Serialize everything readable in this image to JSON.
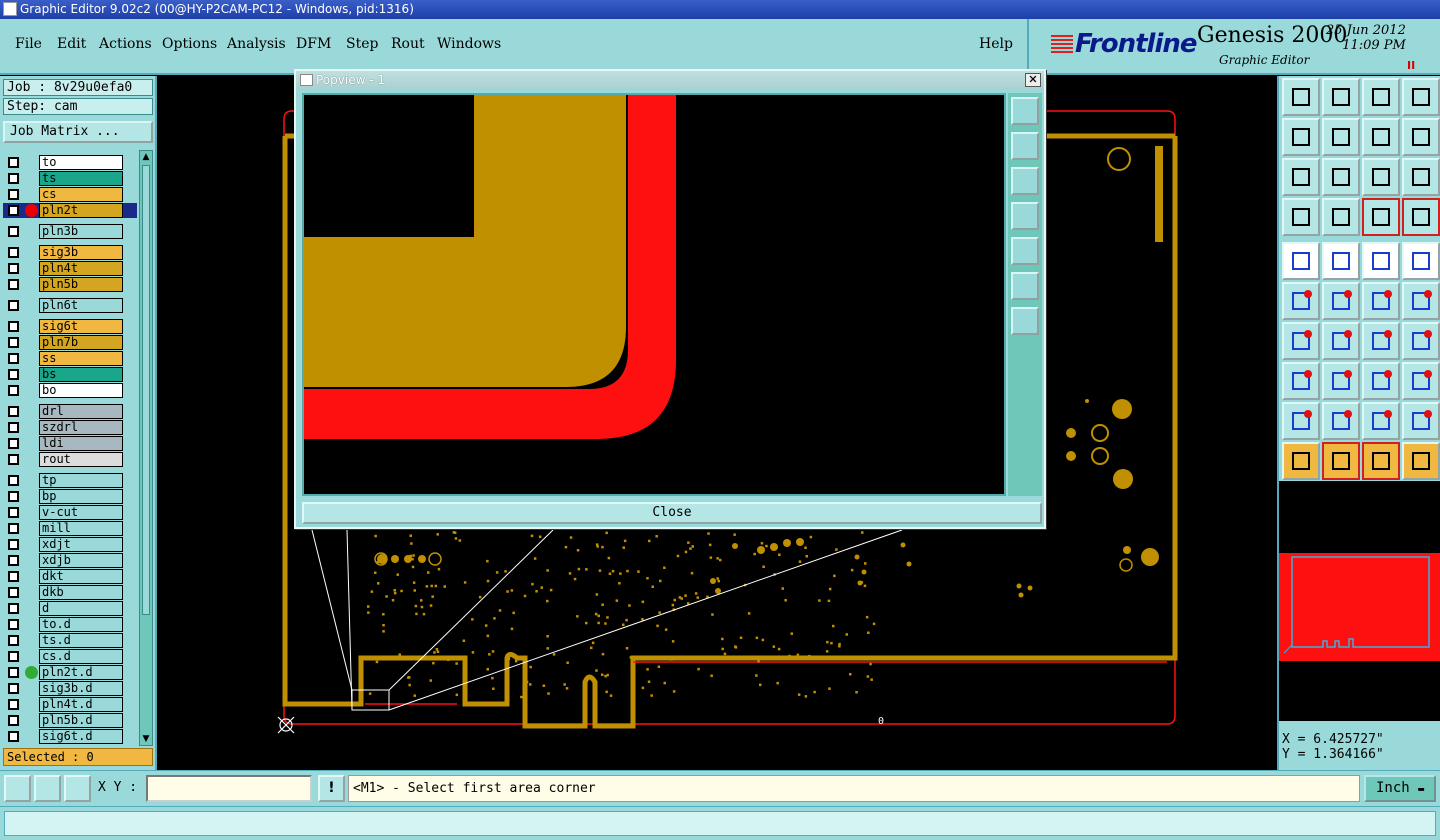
{
  "window": {
    "title": "Graphic Editor 9.02c2 (00@HY-P2CAM-PC12 - Windows, pid:1316)"
  },
  "menu": {
    "items": [
      "File",
      "Edit",
      "Actions",
      "Options",
      "Analysis",
      "DFM",
      "Step",
      "Rout",
      "Windows"
    ],
    "help": "Help"
  },
  "brand": {
    "logo": "Frontline",
    "product": "Genesis 2000",
    "subtitle": "Graphic Editor",
    "date": "25 Jun 2012",
    "time": "11:09 PM",
    "pause_glyph": "II"
  },
  "job": {
    "job_label": "Job : 8v29u0efa0",
    "step_label": "Step: cam",
    "matrix_button": "Job Matrix ..."
  },
  "layers": [
    {
      "name": "to",
      "color": "#ffffff"
    },
    {
      "name": "ts",
      "color": "#1aa68a"
    },
    {
      "name": "cs",
      "color": "#f0b840"
    },
    {
      "name": "pln2t",
      "color": "#d4a520",
      "active": true
    },
    {
      "name": "pln3b",
      "color": "#9ad9d9"
    },
    {
      "name": "sig3b",
      "color": "#f0b840"
    },
    {
      "name": "pln4t",
      "color": "#d4a520"
    },
    {
      "name": "pln5b",
      "color": "#d4a520"
    },
    {
      "name": "pln6t",
      "color": "#9ad9d9"
    },
    {
      "name": "sig6t",
      "color": "#f0b840"
    },
    {
      "name": "pln7b",
      "color": "#d4a520"
    },
    {
      "name": "ss",
      "color": "#f0b840"
    },
    {
      "name": "bs",
      "color": "#1aa68a"
    },
    {
      "name": "bo",
      "color": "#ffffff"
    },
    {
      "name": "drl",
      "color": "#a8b8c0"
    },
    {
      "name": "szdrl",
      "color": "#a8b8c0"
    },
    {
      "name": "ldi",
      "color": "#a8b8c0"
    },
    {
      "name": "rout",
      "color": "#dcdcdc"
    },
    {
      "name": "tp",
      "color": "#9ad9d9"
    },
    {
      "name": "bp",
      "color": "#9ad9d9"
    },
    {
      "name": "v-cut",
      "color": "#9ad9d9"
    },
    {
      "name": "mill",
      "color": "#9ad9d9"
    },
    {
      "name": "xdjt",
      "color": "#9ad9d9"
    },
    {
      "name": "xdjb",
      "color": "#9ad9d9"
    },
    {
      "name": "dkt",
      "color": "#9ad9d9"
    },
    {
      "name": "dkb",
      "color": "#9ad9d9"
    },
    {
      "name": "d",
      "color": "#9ad9d9"
    },
    {
      "name": "to.d",
      "color": "#9ad9d9"
    },
    {
      "name": "ts.d",
      "color": "#9ad9d9"
    },
    {
      "name": "cs.d",
      "color": "#9ad9d9"
    },
    {
      "name": "pln2t.d",
      "color": "#9ad9d9",
      "green": true
    },
    {
      "name": "sig3b.d",
      "color": "#9ad9d9"
    },
    {
      "name": "pln4t.d",
      "color": "#9ad9d9"
    },
    {
      "name": "pln5b.d",
      "color": "#9ad9d9"
    },
    {
      "name": "sig6t.d",
      "color": "#9ad9d9"
    }
  ],
  "selected": "Selected : 0",
  "popview": {
    "title": "Popview - 1",
    "close_label": "Close",
    "close_glyph": "✕"
  },
  "canvas": {
    "step_number": "2",
    "origin_marker": "0"
  },
  "coords": {
    "x": "X = 6.425727\"",
    "y": "Y = 1.364166\""
  },
  "command": {
    "xy_label": "X Y :",
    "xy_value": "",
    "warn_glyph": "!",
    "prompt": "<M1> - Select first area corner",
    "units": "Inch"
  },
  "colors": {
    "panel": "#9ad9d9",
    "copper": "#c09000",
    "outline": "#ff1010"
  }
}
